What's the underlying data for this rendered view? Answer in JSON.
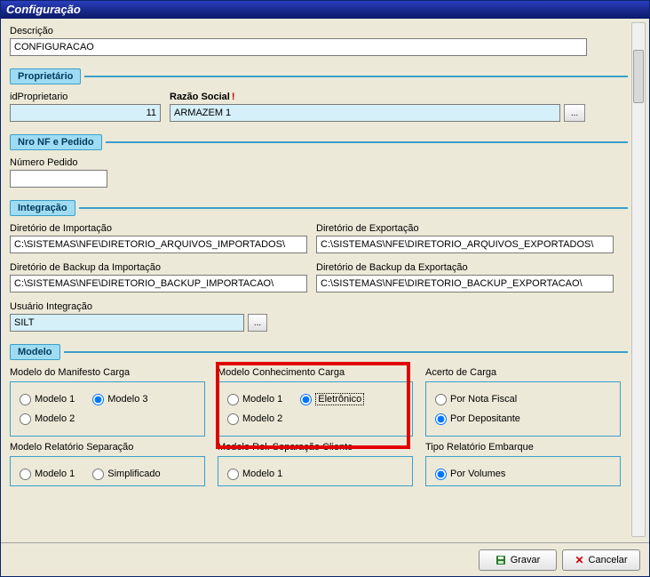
{
  "window": {
    "title": "Configuração"
  },
  "descricao": {
    "label": "Descrição",
    "value": "CONFIGURACAO"
  },
  "proprietario": {
    "section": "Proprietário",
    "id_label": "idProprietario",
    "id_value": "11",
    "razao_label": "Razão Social",
    "razao_value": "ARMAZEM 1",
    "lookup": "..."
  },
  "nronf": {
    "section": "Nro NF e Pedido",
    "numero_pedido_label": "Número Pedido",
    "numero_pedido_value": ""
  },
  "integracao": {
    "section": "Integração",
    "dir_import_label": "Diretório de Importação",
    "dir_import_value": "C:\\SISTEMAS\\NFE\\DIRETORIO_ARQUIVOS_IMPORTADOS\\",
    "dir_export_label": "Diretório de Exportação",
    "dir_export_value": "C:\\SISTEMAS\\NFE\\DIRETORIO_ARQUIVOS_EXPORTADOS\\",
    "dir_bkimport_label": "Diretório de Backup da Importação",
    "dir_bkimport_value": "C:\\SISTEMAS\\NFE\\DIRETORIO_BACKUP_IMPORTACAO\\",
    "dir_bkexport_label": "Diretório de Backup da Exportação",
    "dir_bkexport_value": "C:\\SISTEMAS\\NFE\\DIRETORIO_BACKUP_EXPORTACAO\\",
    "usuario_label": "Usuário Integração",
    "usuario_value": "SILT",
    "lookup": "..."
  },
  "modelo": {
    "section": "Modelo",
    "manifesto": {
      "title": "Modelo do Manifesto Carga",
      "opt1": "Modelo 1",
      "opt2": "Modelo 2",
      "opt3": "Modelo 3"
    },
    "conhecimento": {
      "title": "Modelo Conhecimento Carga",
      "opt1": "Modelo 1",
      "opt2": "Modelo 2",
      "opt3": "Eletrônico"
    },
    "acerto": {
      "title": "Acerto de Carga",
      "opt1": "Por Nota Fiscal",
      "opt2": "Por Depositante"
    },
    "rel_sep": {
      "title": "Modelo Relatório Separação",
      "opt1": "Modelo 1",
      "opt2": "Simplificado"
    },
    "rel_sep_cli": {
      "title": "Modelo Rel. Separação Cliente",
      "opt1": "Modelo 1"
    },
    "tipo_emb": {
      "title": "Tipo Relatório Embarque",
      "opt1": "Por Volumes"
    }
  },
  "footer": {
    "gravar": "Gravar",
    "cancelar": "Cancelar"
  }
}
